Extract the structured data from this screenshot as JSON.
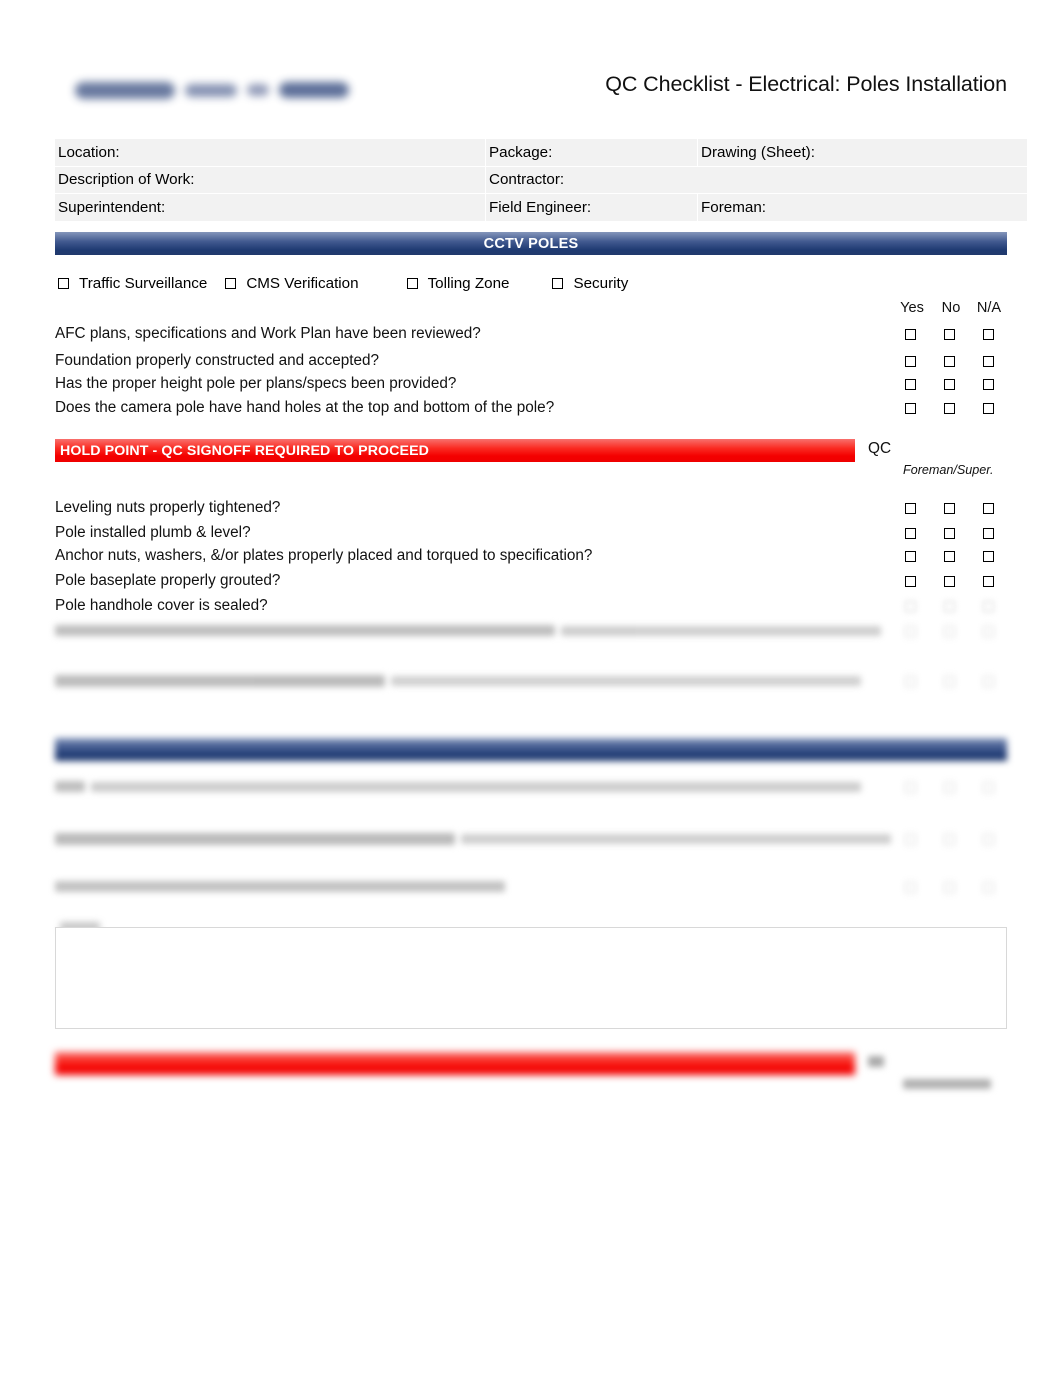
{
  "document": {
    "title": "QC Checklist - Electrical: Poles Installation",
    "logo_alt": "company-logo-redacted"
  },
  "info_fields": [
    [
      {
        "label": "Location:",
        "value": ""
      },
      {
        "label": "Package:",
        "value": ""
      },
      {
        "label": "Drawing (Sheet):",
        "value": ""
      }
    ],
    [
      {
        "label": "Description of Work:",
        "value": ""
      },
      {
        "label": "Contractor:",
        "value": ""
      }
    ],
    [
      {
        "label": "Superintendent:",
        "value": ""
      },
      {
        "label": "Field Engineer:",
        "value": ""
      },
      {
        "label": "Foreman:",
        "value": ""
      }
    ]
  ],
  "section_one": {
    "banner": "CCTV POLES",
    "types": [
      {
        "label": "Traffic Surveillance",
        "checked": false
      },
      {
        "label": "CMS Verification",
        "checked": false
      },
      {
        "label": "Tolling Zone",
        "checked": false
      },
      {
        "label": "Security",
        "checked": false
      }
    ],
    "columns": [
      "Yes",
      "No",
      "N/A"
    ],
    "questions": [
      "AFC plans, specifications and Work Plan have been reviewed?",
      "Foundation properly constructed and accepted?",
      "Has the proper height pole per plans/specs been provided?",
      "Does the camera pole have hand holes at the top and bottom of the pole?"
    ]
  },
  "hold_point_one": {
    "text": "HOLD POINT - QC SIGNOFF REQUIRED TO PROCEED",
    "qc_label": "QC",
    "foreman_label": "Foreman/Super."
  },
  "section_two": {
    "questions": [
      "Leveling nuts properly tightened?",
      "Pole installed plumb & level?",
      "Anchor nuts, washers, &/or plates properly placed and torqued to specification?",
      "Pole baseplate properly grouted?",
      "Pole handhole cover is sealed?"
    ],
    "redacted_questions": [
      "",
      ""
    ]
  },
  "section_three": {
    "banner": "",
    "redacted_questions": [
      "",
      "",
      ""
    ]
  },
  "notes": {
    "label": "",
    "value": ""
  },
  "hold_point_two": {
    "text": "",
    "qc_label": "",
    "foreman_label": ""
  },
  "colors": {
    "banner_top": "#8496bb",
    "banner_bottom": "#1f3a72",
    "hold_top": "#f8706d",
    "hold_bottom": "#ef0000",
    "field_bg": "#f2f2f2"
  }
}
